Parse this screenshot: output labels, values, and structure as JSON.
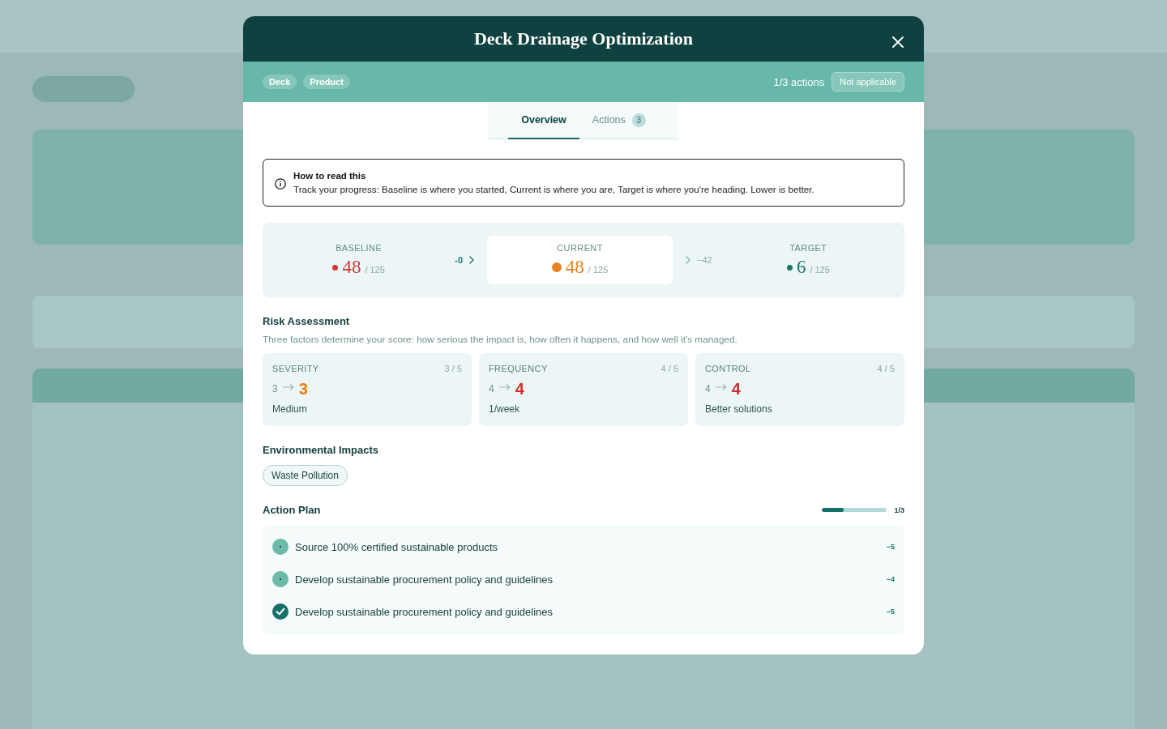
{
  "modal": {
    "title": "Deck Drainage Optimization",
    "tags": [
      "Deck",
      "Product"
    ],
    "actions_count": "1/3 actions",
    "status_button": "Not applicable"
  },
  "tabs": [
    {
      "label": "Overview",
      "selected": true
    },
    {
      "label": "Actions",
      "badge": "3",
      "selected": false
    }
  ],
  "info": {
    "title": "How to read this",
    "text": "Track your progress: Baseline is where you started, Current is where you are, Target is where you're heading. Lower is better."
  },
  "progress": {
    "steps": [
      {
        "label": "BASELINE",
        "value": "48",
        "max": "/ 125",
        "color": "#d63434",
        "highlighted": false
      },
      {
        "label": "CURRENT",
        "value": "48",
        "max": "/ 125",
        "color": "#e8821e",
        "highlighted": true
      },
      {
        "label": "TARGET",
        "value": "6",
        "max": "/ 125",
        "color": "#167a6b",
        "highlighted": false
      }
    ],
    "deltas": [
      {
        "kind": "achieved",
        "text": "-0"
      },
      {
        "kind": "remaining",
        "text": "−42"
      }
    ]
  },
  "risk": {
    "title": "Risk Assessment",
    "description": "Three factors determine your score: how serious the impact is, how often it happens, and how well it's managed.",
    "factors": [
      {
        "label": "SEVERITY",
        "score": "3 / 5",
        "from": "3",
        "to": "3",
        "color": "#f07a0c",
        "note": "Medium"
      },
      {
        "label": "FREQUENCY",
        "score": "4 / 5",
        "from": "4",
        "to": "4",
        "color": "#d32f2f",
        "note": "1/week"
      },
      {
        "label": "CONTROL",
        "score": "4 / 5",
        "from": "4",
        "to": "4",
        "color": "#d32f2f",
        "note": "Better solutions"
      }
    ]
  },
  "impacts": {
    "title": "Environmental Impacts",
    "items": [
      "Waste Pollution"
    ]
  },
  "action_plan": {
    "title": "Action Plan",
    "level": 0.333,
    "progress_text": "1/3",
    "actions": [
      {
        "text": "Source 100% certified sustainable products",
        "points": "−5",
        "checked": false
      },
      {
        "text": "Develop sustainable procurement policy and guidelines",
        "points": "−4",
        "checked": false
      },
      {
        "text": "Develop sustainable procurement policy and guidelines",
        "points": "−5",
        "checked": true
      }
    ]
  }
}
